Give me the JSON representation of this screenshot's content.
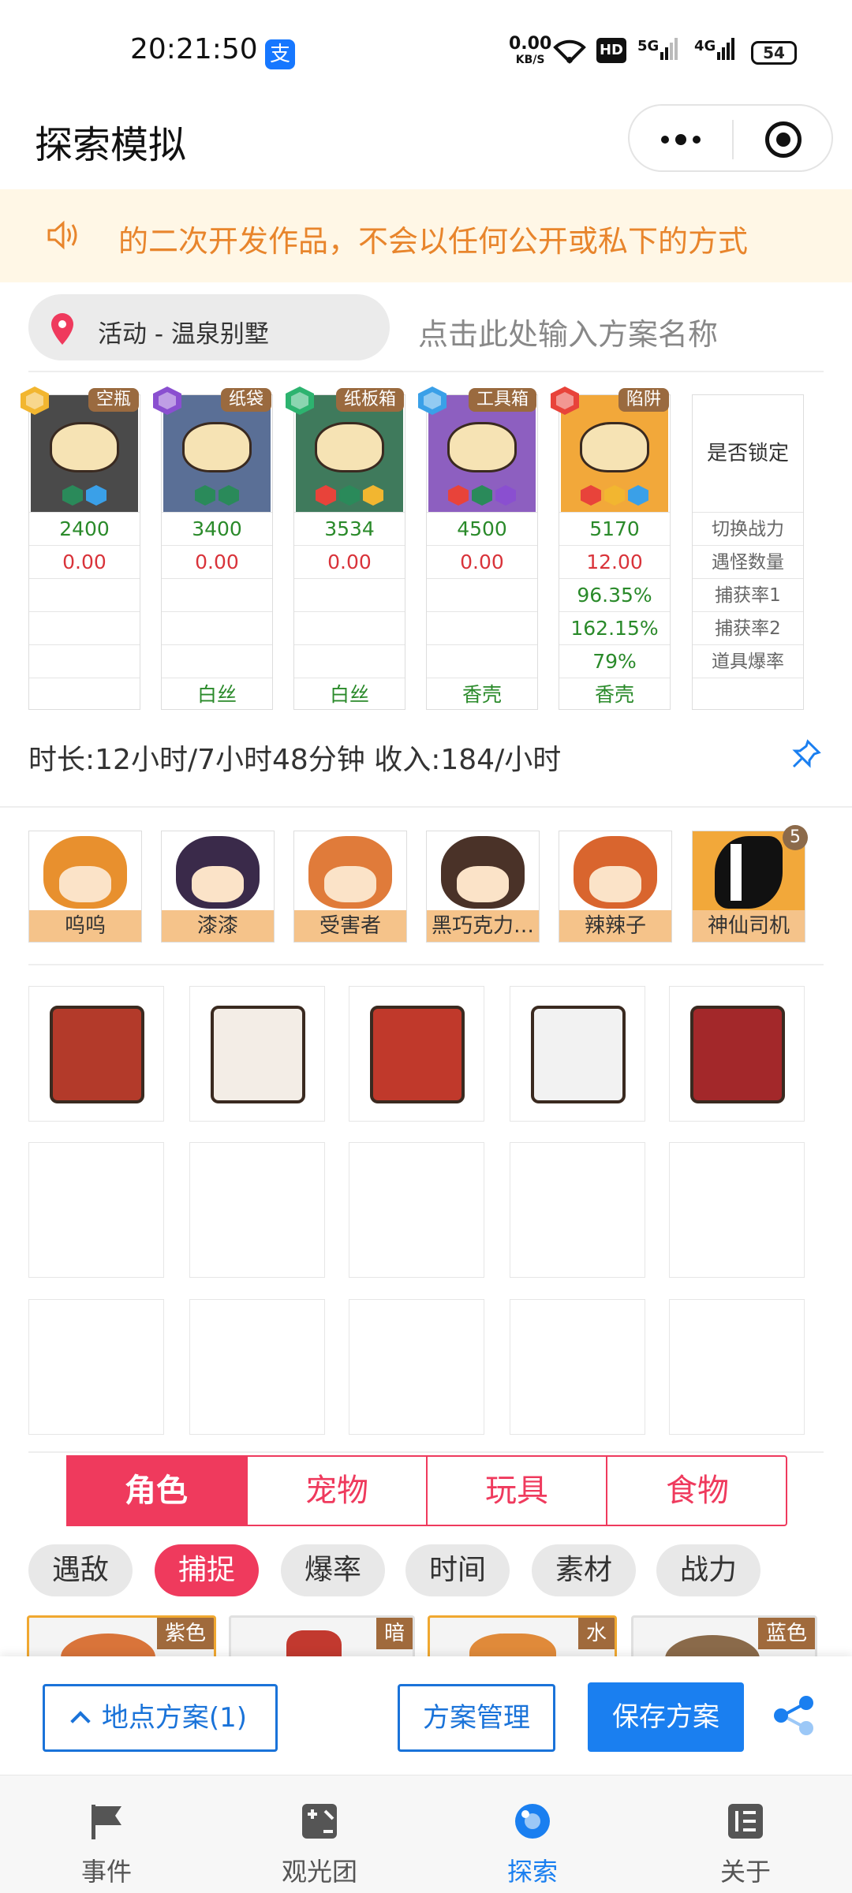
{
  "status_bar": {
    "time": "20:21:50",
    "net_speed": "0.00",
    "net_unit": "KB/S",
    "hd": "HD",
    "sig1": "5G",
    "sig2": "4G",
    "battery": "54"
  },
  "header": {
    "title": "探索模拟"
  },
  "notice": {
    "text": "的二次开发作品，不会以任何公开或私下的方式"
  },
  "location": {
    "label": "活动 - 温泉别墅",
    "plan_placeholder": "点击此处输入方案名称"
  },
  "toys": [
    {
      "tag": "空瓶",
      "power": "2400",
      "encounter": "0.00",
      "catch1": "",
      "catch2": "",
      "drop": "",
      "bonus": "",
      "color": "#4a4a4a"
    },
    {
      "tag": "纸袋",
      "power": "3400",
      "encounter": "0.00",
      "catch1": "",
      "catch2": "",
      "drop": "",
      "bonus": "白丝",
      "color": "#5a6f96"
    },
    {
      "tag": "纸板箱",
      "power": "3534",
      "encounter": "0.00",
      "catch1": "",
      "catch2": "",
      "drop": "",
      "bonus": "白丝",
      "color": "#3f7a5c"
    },
    {
      "tag": "工具箱",
      "power": "4500",
      "encounter": "0.00",
      "catch1": "",
      "catch2": "",
      "drop": "",
      "bonus": "香壳",
      "color": "#8d5fc0"
    },
    {
      "tag": "陷阱",
      "power": "5170",
      "encounter": "12.00",
      "catch1": "96.35%",
      "catch2": "162.15%",
      "drop": "79%",
      "bonus": "香壳",
      "color": "#f2a83a"
    }
  ],
  "lock_column": {
    "header": "是否锁定",
    "rows": [
      "切换战力",
      "遇怪数量",
      "捕获率1",
      "捕获率2",
      "道具爆率"
    ]
  },
  "summary": {
    "text": "时长:12小时/7小时48分钟 收入:184/小时"
  },
  "characters": [
    {
      "name": "呜呜",
      "color": "#e8902e"
    },
    {
      "name": "漆漆",
      "color": "#3a2a4a"
    },
    {
      "name": "受害者",
      "color": "#e07b3a"
    },
    {
      "name": "黑巧克力…",
      "color": "#4a3228"
    },
    {
      "name": "辣辣子",
      "color": "#d9652e"
    },
    {
      "name": "神仙司机",
      "color": "#f2a83a"
    }
  ],
  "character_badge": "5",
  "tabs": [
    "角色",
    "宠物",
    "玩具",
    "食物"
  ],
  "filters": [
    "遇敌",
    "捕捉",
    "爆率",
    "时间",
    "素材",
    "战力"
  ],
  "cards": [
    "紫色",
    "暗",
    "水",
    "蓝色"
  ],
  "buttons": {
    "location_plan": "地点方案(1)",
    "plan_manage": "方案管理",
    "save_plan": "保存方案"
  },
  "nav": [
    "事件",
    "观光团",
    "探索",
    "关于"
  ]
}
